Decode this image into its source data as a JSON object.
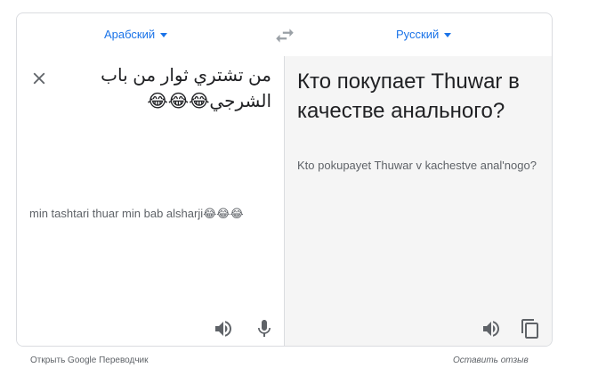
{
  "lang_bar": {
    "source_language": "Арабский",
    "target_language": "Русский"
  },
  "source": {
    "text": "من تشتري ثوار من باب الشرجي😂😂😂",
    "transliteration": "min tashtari thuar min bab alsharji😂😂😂"
  },
  "target": {
    "text": "Кто покупает Thuwar в качестве анального?",
    "transliteration": "Kto pokupayet Thuwar v kachestve anal'nogo?"
  },
  "icons": {
    "swap": "swap-arrows-icon",
    "close": "close-icon",
    "listen": "speaker-icon",
    "mic": "microphone-icon",
    "copy": "copy-icon"
  },
  "footer": {
    "open_link": "Открыть Google Переводчик",
    "feedback_link": "Оставить отзыв"
  },
  "colors": {
    "accent": "#1a73e8",
    "target_panel_bg": "#f5f5f5",
    "border": "#dadce0"
  }
}
